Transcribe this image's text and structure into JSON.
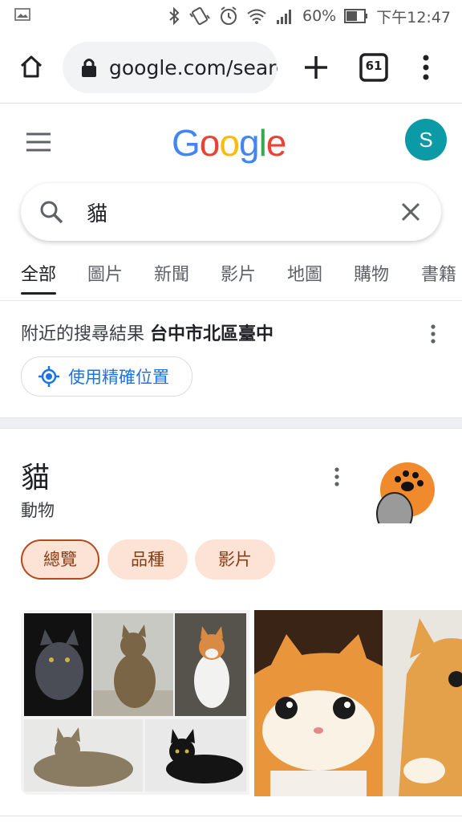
{
  "status_bar": {
    "battery": "60%",
    "time": "下午12:47",
    "icons": [
      "image-icon",
      "bluetooth-icon",
      "vibrate-icon",
      "alarm-icon",
      "wifi-icon",
      "signal-icon",
      "battery-icon"
    ]
  },
  "browser": {
    "url": "google.com/search",
    "tab_count": "61"
  },
  "google": {
    "logo_text": "Google",
    "avatar_letter": "S",
    "colors": {
      "blue": "#4285F4",
      "red": "#EA4335",
      "yellow": "#FBBC05",
      "green": "#34A853",
      "avatar": "#0b9aa6"
    }
  },
  "search": {
    "query": "貓"
  },
  "tabs": [
    {
      "label": "全部",
      "active": true
    },
    {
      "label": "圖片"
    },
    {
      "label": "新聞"
    },
    {
      "label": "影片"
    },
    {
      "label": "地圖"
    },
    {
      "label": "購物"
    },
    {
      "label": "書籍"
    }
  ],
  "location": {
    "prefix": "附近的搜尋結果",
    "place": "台中市北區臺中",
    "button_label": "使用精確位置"
  },
  "knowledge_panel": {
    "title": "貓",
    "subtitle": "動物",
    "chips": [
      "總覽",
      "品種",
      "影片"
    ]
  }
}
